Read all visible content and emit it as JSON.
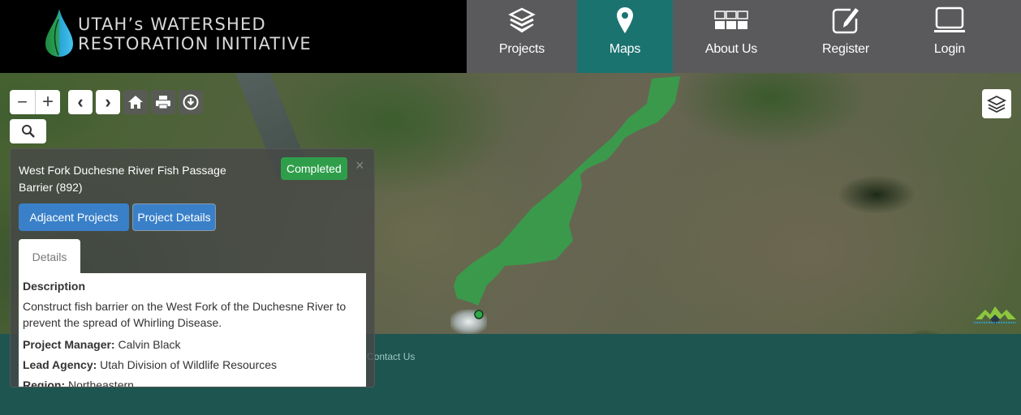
{
  "header": {
    "logo": {
      "line1": "UTAH’s WATERSHED",
      "line2": "RESTORATION INITIATIVE",
      "icon": "water-drop-leaf-icon"
    },
    "nav": [
      {
        "label": "Projects",
        "icon": "layers-icon",
        "active": false
      },
      {
        "label": "Maps",
        "icon": "map-pin-icon",
        "active": true
      },
      {
        "label": "About Us",
        "icon": "grid-icon",
        "active": false
      },
      {
        "label": "Register",
        "icon": "edit-icon",
        "active": false
      },
      {
        "label": "Login",
        "icon": "laptop-icon",
        "active": false
      }
    ],
    "colors": {
      "active": "#1b7370",
      "nav_bg": "#5a5a5c"
    }
  },
  "map": {
    "controls": {
      "zoom_out": "−",
      "zoom_in": "+",
      "back": "‹",
      "forward": "›",
      "icons": [
        "home-icon",
        "print-icon",
        "download-icon",
        "search-icon",
        "layers-icon"
      ]
    },
    "feature_color": "#2fa84a"
  },
  "popup": {
    "title": "West Fork Duchesne River Fish Passage Barrier (892)",
    "status": "Completed",
    "status_color": "#2f9e4a",
    "close": "×",
    "buttons": {
      "adjacent": "Adjacent Projects",
      "details": "Project Details"
    },
    "tab": "Details",
    "panel": {
      "description_heading": "Description",
      "description": "Construct fish barrier on the West Fork of the Duchesne River to prevent the spread of Whirling Disease.",
      "fields": [
        {
          "label": "Project Manager:",
          "value": "Calvin Black"
        },
        {
          "label": "Lead Agency:",
          "value": "Utah Division of Wildlife Resources"
        },
        {
          "label": "Region:",
          "value": "Northeastern"
        }
      ]
    }
  },
  "footer": {
    "contact": "Contact Us"
  }
}
